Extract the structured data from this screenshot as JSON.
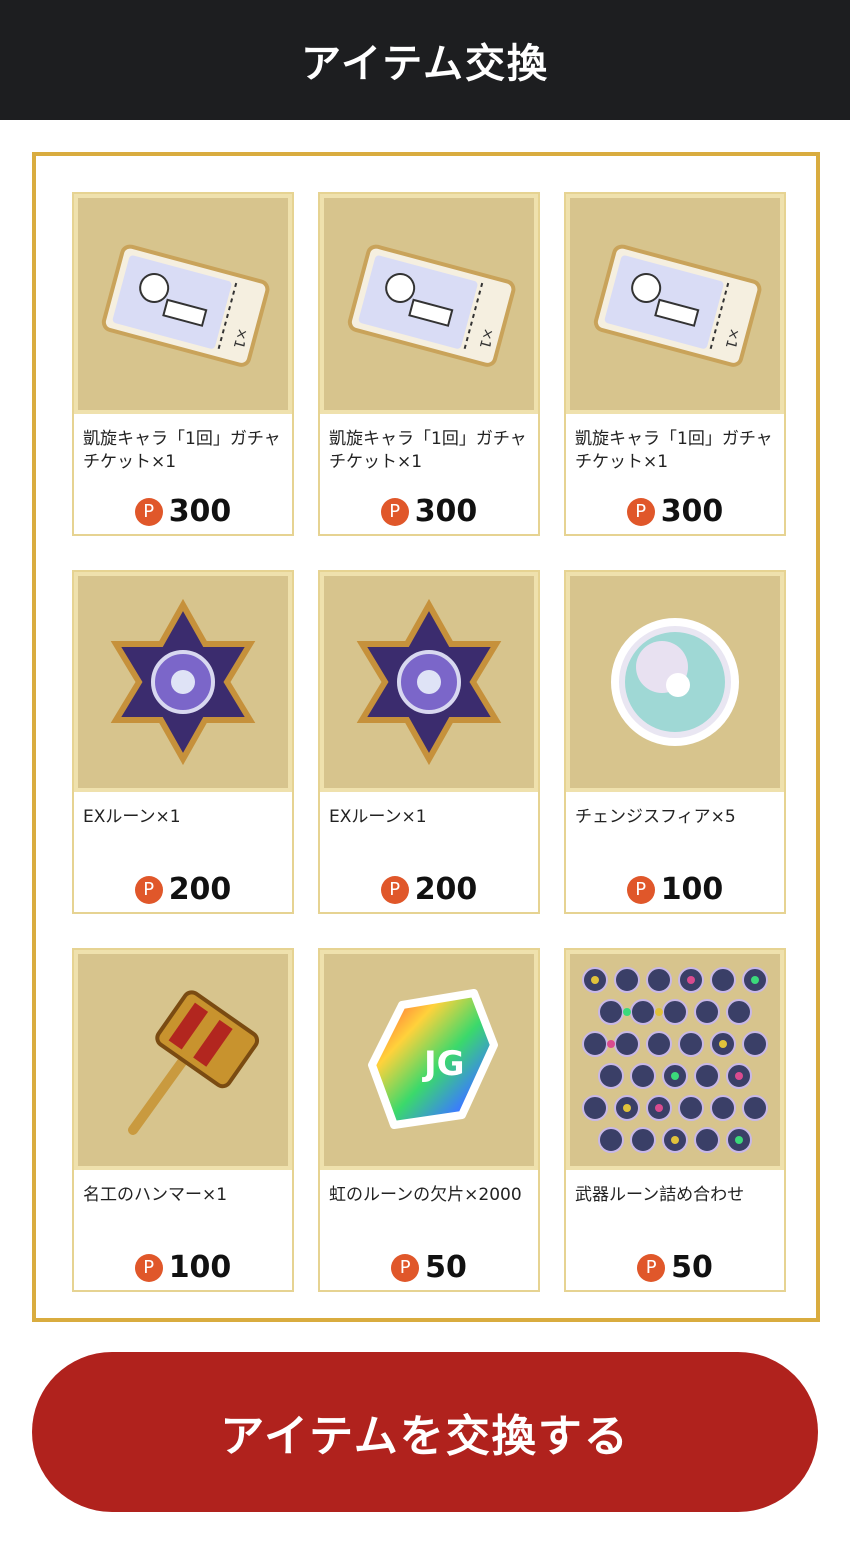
{
  "header": {
    "title": "アイテム交換"
  },
  "currency_symbol": "P",
  "items": [
    {
      "name": "凱旋キャラ「1回」ガチャチケット×1",
      "price": "300",
      "icon": "gacha-ticket-icon"
    },
    {
      "name": "凱旋キャラ「1回」ガチャチケット×1",
      "price": "300",
      "icon": "gacha-ticket-icon"
    },
    {
      "name": "凱旋キャラ「1回」ガチャチケット×1",
      "price": "300",
      "icon": "gacha-ticket-icon"
    },
    {
      "name": "EXルーン×1",
      "price": "200",
      "icon": "ex-rune-icon"
    },
    {
      "name": "EXルーン×1",
      "price": "200",
      "icon": "ex-rune-icon"
    },
    {
      "name": "チェンジスフィア×5",
      "price": "100",
      "icon": "change-sphere-icon"
    },
    {
      "name": "名工のハンマー×1",
      "price": "100",
      "icon": "hammer-icon"
    },
    {
      "name": "虹のルーンの欠片×2000",
      "price": "50",
      "icon": "rainbow-rune-shard-icon"
    },
    {
      "name": "武器ルーン詰め合わせ",
      "price": "50",
      "icon": "weapon-rune-set-icon"
    }
  ],
  "exchange_button_label": "アイテムを交換する",
  "colors": {
    "header_bg": "#1d1e20",
    "panel_border": "#d9ac3f",
    "thumb_bg": "#d7c48d",
    "badge": "#e0572a",
    "button": "#b0221d"
  }
}
